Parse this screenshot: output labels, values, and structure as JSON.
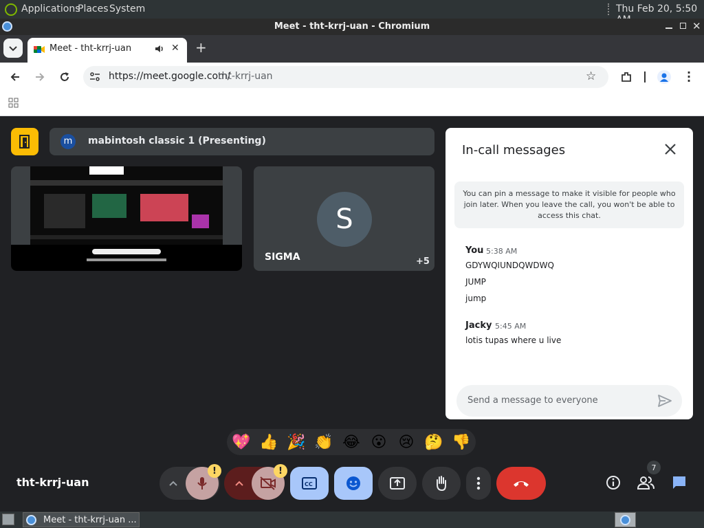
{
  "top_panel": {
    "applications": "Applications",
    "places": "Places",
    "system": "System",
    "clock": "Thu Feb 20,  5:50 AM"
  },
  "window": {
    "title": "Meet - tht-krrj-uan - Chromium"
  },
  "tab": {
    "title": "Meet - tht-krrj-uan"
  },
  "address": {
    "scheme_host": "https://meet.google.com/",
    "path": "tht-krrj-uan"
  },
  "presenting": {
    "avatar_letter": "m",
    "label": "mabintosh classic 1 (Presenting)"
  },
  "tiles": {
    "sigma": {
      "letter": "S",
      "name": "SIGMA",
      "more": "+5"
    }
  },
  "chat": {
    "title": "In-call messages",
    "notice": "You can pin a message to make it visible for people who join later. When you leave the call, you won't be able to access this chat.",
    "groups": [
      {
        "sender": "You",
        "time": "5:38 AM",
        "messages": [
          "GDYWQIUNDQWDWQ",
          "JUMP",
          "jump"
        ]
      },
      {
        "sender": "Jacky",
        "time": "5:45 AM",
        "messages": [
          "lotis tupas where u live"
        ]
      }
    ],
    "input_placeholder": "Send a message to everyone"
  },
  "reactions": [
    "💖",
    "👍",
    "🎉",
    "👏",
    "😂",
    "😮",
    "😢",
    "🤔",
    "👎"
  ],
  "meeting_code": "tht-krrj-uan",
  "participants_count": "7",
  "taskbar": {
    "window_label": "Meet - tht-krrj-uan ..."
  },
  "colors": {
    "accent_blue": "#a8c7fa",
    "hangup_red": "#dc362e",
    "meet_bg": "#202124",
    "warning_yellow": "#fdd663"
  }
}
